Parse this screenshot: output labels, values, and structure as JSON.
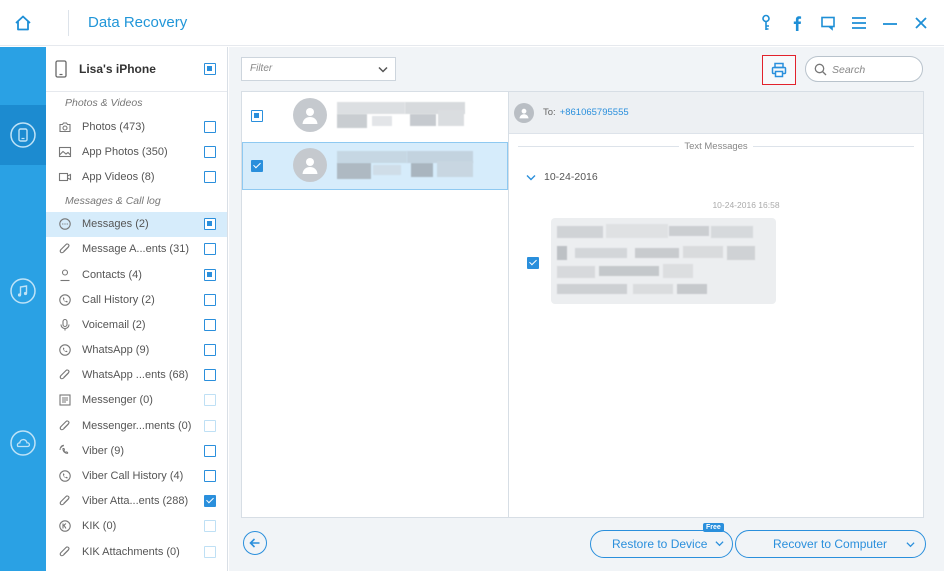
{
  "app": {
    "title": "Data Recovery",
    "titlebar_icons": [
      "key-icon",
      "facebook-icon",
      "feedback-icon",
      "menu-icon",
      "minimize-icon",
      "close-icon"
    ],
    "accent_color": "#2a8fdc",
    "rail_color": "#2aa1e4"
  },
  "rail": {
    "items": [
      {
        "name": "device-icon",
        "active": true
      },
      {
        "name": "music-icon",
        "active": false
      },
      {
        "name": "cloud-icon",
        "active": false
      }
    ]
  },
  "device": {
    "name": "Lisa's iPhone",
    "check_state": "partial"
  },
  "categories": {
    "photos_section": "Photos & Videos",
    "messages_section": "Messages & Call log",
    "photos": [
      {
        "icon": "camera-icon",
        "label": "Photos (473)",
        "check": "empty"
      },
      {
        "icon": "image-icon",
        "label": "App Photos (350)",
        "check": "empty"
      },
      {
        "icon": "video-icon",
        "label": "App Videos (8)",
        "check": "empty"
      }
    ],
    "messages": [
      {
        "icon": "message-icon",
        "label": "Messages (2)",
        "check": "partial",
        "selected": true
      },
      {
        "icon": "attachment-icon",
        "label": "Message A...ents (31)",
        "check": "empty"
      },
      {
        "icon": "contact-icon",
        "label": "Contacts (4)",
        "check": "partial"
      },
      {
        "icon": "phone-icon",
        "label": "Call History (2)",
        "check": "empty"
      },
      {
        "icon": "voicemail-icon",
        "label": "Voicemail (2)",
        "check": "empty"
      },
      {
        "icon": "whatsapp-icon",
        "label": "WhatsApp (9)",
        "check": "empty"
      },
      {
        "icon": "attachment-icon",
        "label": "WhatsApp ...ents (68)",
        "check": "empty"
      },
      {
        "icon": "messenger-icon",
        "label": "Messenger (0)",
        "check": "faded"
      },
      {
        "icon": "attachment-icon",
        "label": "Messenger...ments (0)",
        "check": "faded"
      },
      {
        "icon": "viber-icon",
        "label": "Viber (9)",
        "check": "empty"
      },
      {
        "icon": "phone-icon",
        "label": "Viber Call History (4)",
        "check": "empty"
      },
      {
        "icon": "attachment-icon",
        "label": "Viber Atta...ents (288)",
        "check": "checked"
      },
      {
        "icon": "kik-icon",
        "label": "KIK (0)",
        "check": "faded"
      },
      {
        "icon": "attachment-icon",
        "label": "KIK Attachments (0)",
        "check": "faded"
      }
    ]
  },
  "toolbar": {
    "filter_value": "Filter",
    "search_placeholder": "Search",
    "print_icon": "printer-icon"
  },
  "conversations": [
    {
      "check": "partial",
      "selected": false
    },
    {
      "check": "checked",
      "selected": true
    }
  ],
  "detail": {
    "to_label": "To:",
    "to_number": "+861065795555",
    "section_title": "Text Messages",
    "date_group": "10-24-2016",
    "message_time": "10-24-2016 16:58",
    "message_check": "checked"
  },
  "footer": {
    "restore_label": "Restore to Device",
    "free_badge": "Free",
    "recover_label": "Recover to Computer"
  }
}
